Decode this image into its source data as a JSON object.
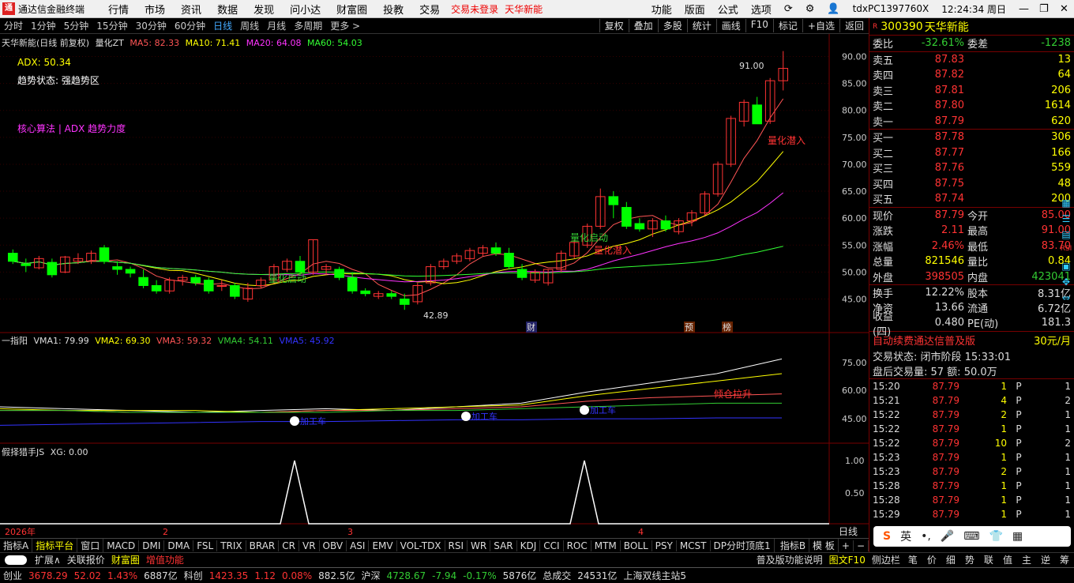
{
  "app": {
    "title": "通达信金融终端",
    "logo": "通"
  },
  "menu": [
    "行情",
    "市场",
    "资讯",
    "数据",
    "发现",
    "问小达",
    "财富圈",
    "投教",
    "交易"
  ],
  "menu_alerts": [
    "交易未登录",
    "天华新能"
  ],
  "menu_right": [
    "功能",
    "版面",
    "公式",
    "选项"
  ],
  "account": "tdxPC1397760X",
  "clock": "12:24:34 周日",
  "periods": [
    "分时",
    "1分钟",
    "5分钟",
    "15分钟",
    "30分钟",
    "60分钟",
    "日线",
    "周线",
    "月线",
    "多周期",
    "更多 >"
  ],
  "active_period": "日线",
  "chart_tools": [
    "复权",
    "叠加",
    "多股",
    "统计",
    "画线",
    "F10",
    "标记",
    "+自选",
    "返回"
  ],
  "main_legend": {
    "name": "天华新能(日线 前复权)",
    "indicator": "量化ZT",
    "ma5": "MA5: 82.33",
    "ma10": "MA10: 71.41",
    "ma20": "MA20: 64.08",
    "ma60": "MA60: 54.03"
  },
  "overlay": {
    "adx": "ADX: 50.34",
    "trend": "趋势状态: 强趋势区",
    "algo": "核心算法 | ADX 趋势力度"
  },
  "annotations": {
    "high": "91.00",
    "low": "42.89",
    "sig1": "量化潜入",
    "sig2": "量化启动",
    "sig3": "量化潜入",
    "sig4": "量化启动",
    "fin": "财",
    "pre": "预",
    "bang": "榜"
  },
  "price_axis": [
    "90.00",
    "85.00",
    "80.00",
    "75.00",
    "70.00",
    "65.00",
    "60.00",
    "55.00",
    "50.00",
    "45.00"
  ],
  "vol_legend": {
    "name": "一指阳",
    "vma1": "VMA1: 79.99",
    "vma2": "VMA2: 69.30",
    "vma3": "VMA3: 59.32",
    "vma4": "VMA4: 54.11",
    "vma5": "VMA5: 45.92"
  },
  "vol_axis": [
    "75.00",
    "60.00",
    "45.00"
  ],
  "vol_marks": {
    "m1": "加工车",
    "m2": "加工车",
    "m3": "加工车",
    "m4": "倾仓拉升"
  },
  "ind_legend": {
    "name": "假择猎手JS",
    "xg": "XG: 0.00"
  },
  "ind_axis": [
    "1.00",
    "0.50"
  ],
  "time_axis": [
    "2026年",
    "2",
    "3",
    "4"
  ],
  "time_axis_label": "日线",
  "quote": {
    "code": "300390",
    "name": "天华新能",
    "weibi_label": "委比",
    "weibi": "-32.61%",
    "weicha_label": "委差",
    "weicha": "-1238",
    "asks": [
      [
        "卖五",
        "87.83",
        "13"
      ],
      [
        "卖四",
        "87.82",
        "64"
      ],
      [
        "卖三",
        "87.81",
        "206"
      ],
      [
        "卖二",
        "87.80",
        "1614"
      ],
      [
        "卖一",
        "87.79",
        "620"
      ]
    ],
    "bids": [
      [
        "买一",
        "87.78",
        "306"
      ],
      [
        "买二",
        "87.77",
        "166"
      ],
      [
        "买三",
        "87.76",
        "559"
      ],
      [
        "买四",
        "87.75",
        "48"
      ],
      [
        "买五",
        "87.74",
        "200"
      ]
    ],
    "stats": [
      [
        "现价",
        "87.79",
        "今开",
        "85.00"
      ],
      [
        "涨跌",
        "2.11",
        "最高",
        "91.00"
      ],
      [
        "涨幅",
        "2.46%",
        "最低",
        "83.70"
      ],
      [
        "总量",
        "821546",
        "量比",
        "0.84"
      ],
      [
        "外盘",
        "398505",
        "内盘",
        "423041"
      ],
      [
        "换手",
        "12.22%",
        "股本",
        "8.31亿"
      ],
      [
        "净资",
        "13.66",
        "流通",
        "6.72亿"
      ],
      [
        "收益(四)",
        "0.480",
        "PE(动)",
        "181.3"
      ]
    ],
    "promo": "自动续费通达信普及版",
    "promo_price": "30元/月",
    "trade_state": "交易状态: 闭市阶段 15:33:01",
    "after": "盘后交易量: 57  额: 50.0万",
    "ticks": [
      [
        "15:20",
        "87.79",
        "1",
        "P",
        "1"
      ],
      [
        "15:21",
        "87.79",
        "4",
        "P",
        "2"
      ],
      [
        "15:22",
        "87.79",
        "2",
        "P",
        "1"
      ],
      [
        "15:22",
        "87.79",
        "1",
        "P",
        "1"
      ],
      [
        "15:22",
        "87.79",
        "10",
        "P",
        "2"
      ],
      [
        "15:23",
        "87.79",
        "1",
        "P",
        "1"
      ],
      [
        "15:23",
        "87.79",
        "2",
        "P",
        "1"
      ],
      [
        "15:28",
        "87.79",
        "1",
        "P",
        "1"
      ],
      [
        "15:28",
        "87.79",
        "1",
        "P",
        "1"
      ],
      [
        "15:29",
        "87.79",
        "1",
        "P",
        "1"
      ]
    ]
  },
  "ime": [
    "S",
    "英"
  ],
  "tabs": [
    "指标A",
    "指标平台",
    "窗口",
    "MACD",
    "DMI",
    "DMA",
    "FSL",
    "TRIX",
    "BRAR",
    "CR",
    "VR",
    "OBV",
    "ASI",
    "EMV",
    "VOL-TDX",
    "RSI",
    "WR",
    "SAR",
    "KDJ",
    "CCI",
    "ROC",
    "MTM",
    "BOLL",
    "PSY",
    "MCST",
    "DP分时顶底1",
    "指标B",
    "模 板"
  ],
  "tabs2": [
    "扩展∧",
    "关联报价",
    "财富圈",
    "增值功能"
  ],
  "tabs2_right": [
    "普及版功能说明",
    "图文F10",
    "侧边栏"
  ],
  "side_tabs": [
    "笔",
    "价",
    "细",
    "势",
    "联",
    "值",
    "主",
    "逆",
    "筹"
  ],
  "status": [
    {
      "label": "创业",
      "v": "3678.29",
      "c": "52.02",
      "p": "1.43%",
      "amt": "6887亿"
    },
    {
      "label": "科创",
      "v": "1423.35",
      "c": "1.12",
      "p": "0.08%",
      "amt": "882.5亿"
    },
    {
      "label": "沪深",
      "v": "4728.67",
      "c": "-7.94",
      "p": "-0.17%",
      "amt": "5876亿"
    }
  ],
  "total_label": "总成交",
  "total": "24531亿",
  "server": "上海双线主站5",
  "chart_data": {
    "type": "candlestick",
    "title": "天华新能(日线 前复权)",
    "ylim": [
      42,
      93
    ],
    "candles": [
      [
        53.5,
        54.2,
        51.5,
        52.0
      ],
      [
        51.5,
        52.5,
        50.0,
        51.2
      ],
      [
        50.8,
        53.0,
        50.5,
        52.5
      ],
      [
        51.8,
        52.5,
        49.0,
        49.5
      ],
      [
        50.0,
        53.0,
        49.8,
        52.8
      ],
      [
        52.0,
        53.5,
        51.5,
        52.5
      ],
      [
        52.0,
        54.0,
        51.5,
        53.5
      ],
      [
        54.5,
        55.0,
        51.5,
        52.0
      ],
      [
        51.0,
        52.0,
        49.5,
        50.5
      ],
      [
        50.5,
        51.0,
        49.0,
        49.8
      ],
      [
        49.0,
        50.5,
        47.0,
        47.5
      ],
      [
        47.5,
        48.5,
        46.0,
        46.5
      ],
      [
        46.5,
        49.0,
        46.0,
        48.5
      ],
      [
        48.5,
        49.5,
        47.5,
        49.0
      ],
      [
        49.0,
        49.5,
        47.5,
        48.0
      ],
      [
        48.5,
        49.0,
        46.0,
        46.5
      ],
      [
        47.5,
        48.5,
        46.5,
        47.5
      ],
      [
        47.5,
        48.0,
        45.0,
        45.5
      ],
      [
        45.0,
        48.0,
        44.5,
        47.0
      ],
      [
        47.5,
        49.0,
        47.0,
        48.5
      ],
      [
        48.5,
        51.5,
        48.0,
        51.0
      ],
      [
        50.5,
        52.5,
        50.0,
        52.0
      ],
      [
        52.0,
        53.0,
        49.5,
        50.0
      ],
      [
        50.0,
        56.0,
        49.5,
        56.0
      ],
      [
        50.5,
        51.5,
        49.5,
        51.0
      ],
      [
        50.5,
        51.0,
        48.5,
        49.0
      ],
      [
        49.0,
        50.0,
        46.0,
        46.5
      ],
      [
        46.5,
        47.0,
        45.5,
        46.0
      ],
      [
        45.5,
        46.5,
        45.0,
        46.0
      ],
      [
        46.0,
        46.5,
        45.0,
        45.5
      ],
      [
        45.0,
        46.0,
        43.0,
        44.0
      ],
      [
        44.5,
        48.0,
        44.0,
        47.5
      ],
      [
        48.0,
        51.5,
        47.5,
        51.0
      ],
      [
        51.0,
        52.5,
        50.5,
        52.0
      ],
      [
        52.0,
        53.5,
        51.5,
        53.0
      ],
      [
        52.5,
        54.5,
        52.0,
        54.0
      ],
      [
        53.5,
        55.0,
        53.0,
        54.5
      ],
      [
        54.5,
        55.5,
        53.0,
        53.5
      ],
      [
        53.5,
        54.5,
        50.5,
        51.0
      ],
      [
        50.5,
        51.5,
        48.5,
        49.0
      ],
      [
        48.5,
        50.5,
        48.0,
        50.0
      ],
      [
        48.0,
        50.5,
        47.5,
        50.5
      ],
      [
        50.5,
        54.0,
        50.0,
        53.5
      ],
      [
        53.0,
        56.0,
        52.5,
        55.5
      ],
      [
        55.0,
        59.0,
        54.5,
        58.5
      ],
      [
        58.5,
        65.5,
        58.0,
        64.0
      ],
      [
        64.0,
        65.0,
        60.0,
        62.5
      ],
      [
        62.0,
        63.0,
        58.0,
        58.5
      ],
      [
        59.0,
        60.0,
        57.5,
        58.0
      ],
      [
        58.0,
        60.0,
        56.5,
        59.5
      ],
      [
        59.5,
        60.5,
        57.5,
        58.0
      ],
      [
        57.5,
        60.0,
        57.0,
        59.5
      ],
      [
        59.5,
        61.5,
        58.5,
        61.0
      ],
      [
        61.0,
        65.0,
        60.5,
        64.5
      ],
      [
        64.5,
        70.5,
        64.0,
        70.0
      ],
      [
        70.0,
        79.0,
        69.5,
        78.5
      ],
      [
        78.0,
        82.0,
        77.0,
        81.5
      ],
      [
        81.0,
        82.5,
        77.5,
        77.5
      ],
      [
        78.0,
        86.0,
        77.5,
        85.5
      ],
      [
        85.5,
        91.0,
        83.7,
        87.79
      ]
    ]
  }
}
